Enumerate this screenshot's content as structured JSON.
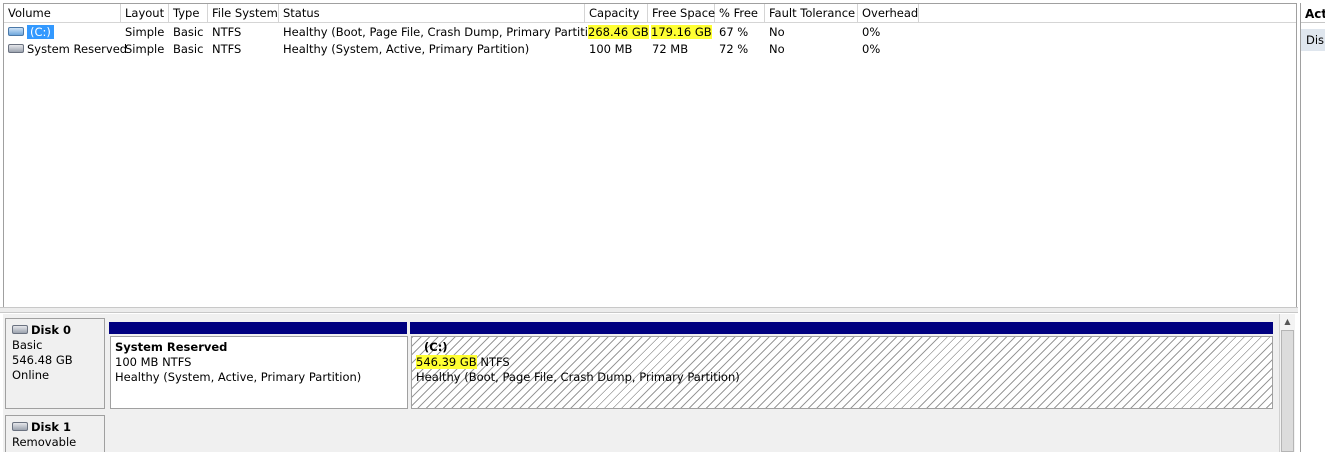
{
  "columns": [
    {
      "key": "volume",
      "label": "Volume"
    },
    {
      "key": "layout",
      "label": "Layout"
    },
    {
      "key": "type",
      "label": "Type"
    },
    {
      "key": "fs",
      "label": "File System"
    },
    {
      "key": "status",
      "label": "Status"
    },
    {
      "key": "capacity",
      "label": "Capacity"
    },
    {
      "key": "free",
      "label": "Free Space"
    },
    {
      "key": "pct",
      "label": "% Free"
    },
    {
      "key": "fault",
      "label": "Fault Tolerance"
    },
    {
      "key": "overhead",
      "label": "Overhead"
    }
  ],
  "volumes": [
    {
      "volume": "(C:)",
      "layout": "Simple",
      "type": "Basic",
      "fs": "NTFS",
      "status": "Healthy (Boot, Page File, Crash Dump, Primary Partition)",
      "capacity": "268.46 GB",
      "free": "179.16 GB",
      "pct": "67 %",
      "fault": "No",
      "overhead": "0%",
      "icon": "disk-volume-icon-blue",
      "selected": true
    },
    {
      "volume": "System Reserved",
      "layout": "Simple",
      "type": "Basic",
      "fs": "NTFS",
      "status": "Healthy (System, Active, Primary Partition)",
      "capacity": "100 MB",
      "free": "72 MB",
      "pct": "72 %",
      "fault": "No",
      "overhead": "0%",
      "icon": "disk-volume-icon-gray",
      "selected": false
    }
  ],
  "actions": {
    "title": "Act",
    "item": "Dis"
  },
  "disks": [
    {
      "name": "Disk 0",
      "type": "Basic",
      "size": "546.48 GB",
      "state": "Online",
      "partitions": [
        {
          "name": "System Reserved",
          "size_fs": "100 MB NTFS",
          "size": "",
          "fs": "",
          "status": "Healthy (System, Active, Primary Partition)"
        },
        {
          "name": "(C:)",
          "size_fs": "",
          "size": "546.39 GB",
          "fs": " NTFS",
          "status": "Healthy (Boot, Page File, Crash Dump, Primary Partition)"
        }
      ]
    },
    {
      "name": "Disk 1",
      "type": "Removable (H:)"
    }
  ],
  "colors": {
    "highlight": "#ffff33",
    "partition_bar": "#000080",
    "selection": "#3399ff"
  }
}
